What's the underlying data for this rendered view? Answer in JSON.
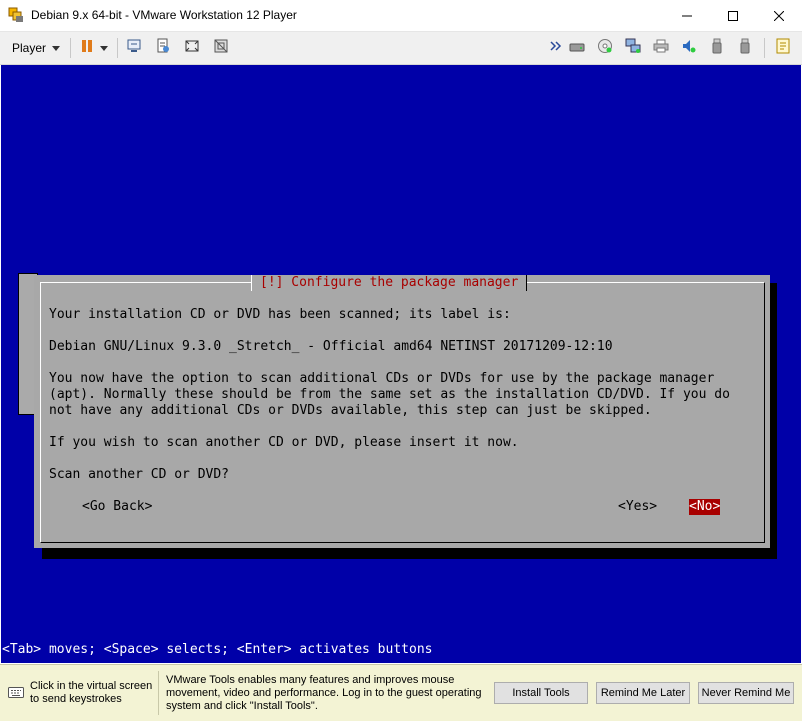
{
  "window": {
    "title": "Debian 9.x 64-bit - VMware Workstation 12 Player",
    "minimize_icon": "minimize-icon",
    "maximize_icon": "maximize-icon",
    "close_icon": "close-icon"
  },
  "toolbar": {
    "player_label": "Player",
    "left_icons": [
      "pause-icon",
      "send-ctrl-alt-del-icon",
      "snapshot-icon",
      "fullscreen-icon",
      "unity-icon"
    ],
    "device_icons": [
      "more-icon",
      "hard-disk-icon",
      "cd-dvd-icon",
      "network-adapter-icon",
      "printer-icon",
      "sound-card-icon",
      "usb-device-icon",
      "usb-device-icon",
      "message-log-icon"
    ]
  },
  "dialog": {
    "title": "[!] Configure the package manager",
    "lines": [
      "Your installation CD or DVD has been scanned; its label is:",
      "Debian GNU/Linux 9.3.0 _Stretch_ - Official amd64 NETINST 20171209-12:10",
      "You now have the option to scan additional CDs or DVDs for use by the package manager",
      "(apt). Normally these should be from the same set as the installation CD/DVD. If you do",
      "not have any additional CDs or DVDs available, this step can just be skipped.",
      "If you wish to scan another CD or DVD, please insert it now.",
      "Scan another CD or DVD?"
    ],
    "go_back_label": "<Go Back>",
    "yes_label": "<Yes>",
    "no_label": "<No>",
    "selected_button": "no"
  },
  "hint": "<Tab> moves; <Space> selects; <Enter> activates buttons",
  "notification": {
    "click_text": "Click in the virtual screen to send keystrokes",
    "message": "VMware Tools enables many features and improves mouse movement, video and performance. Log in to the guest operating system and click \"Install Tools\".",
    "install_tools": "Install Tools",
    "remind_later": "Remind Me Later",
    "never_remind": "Never Remind Me"
  },
  "colors": {
    "guest_background": "#0000a8",
    "dialog_background": "#a8a8a8",
    "dialog_title": "#a80000",
    "selected_button": "#a80000",
    "notification_background": "#f3f3d4"
  }
}
